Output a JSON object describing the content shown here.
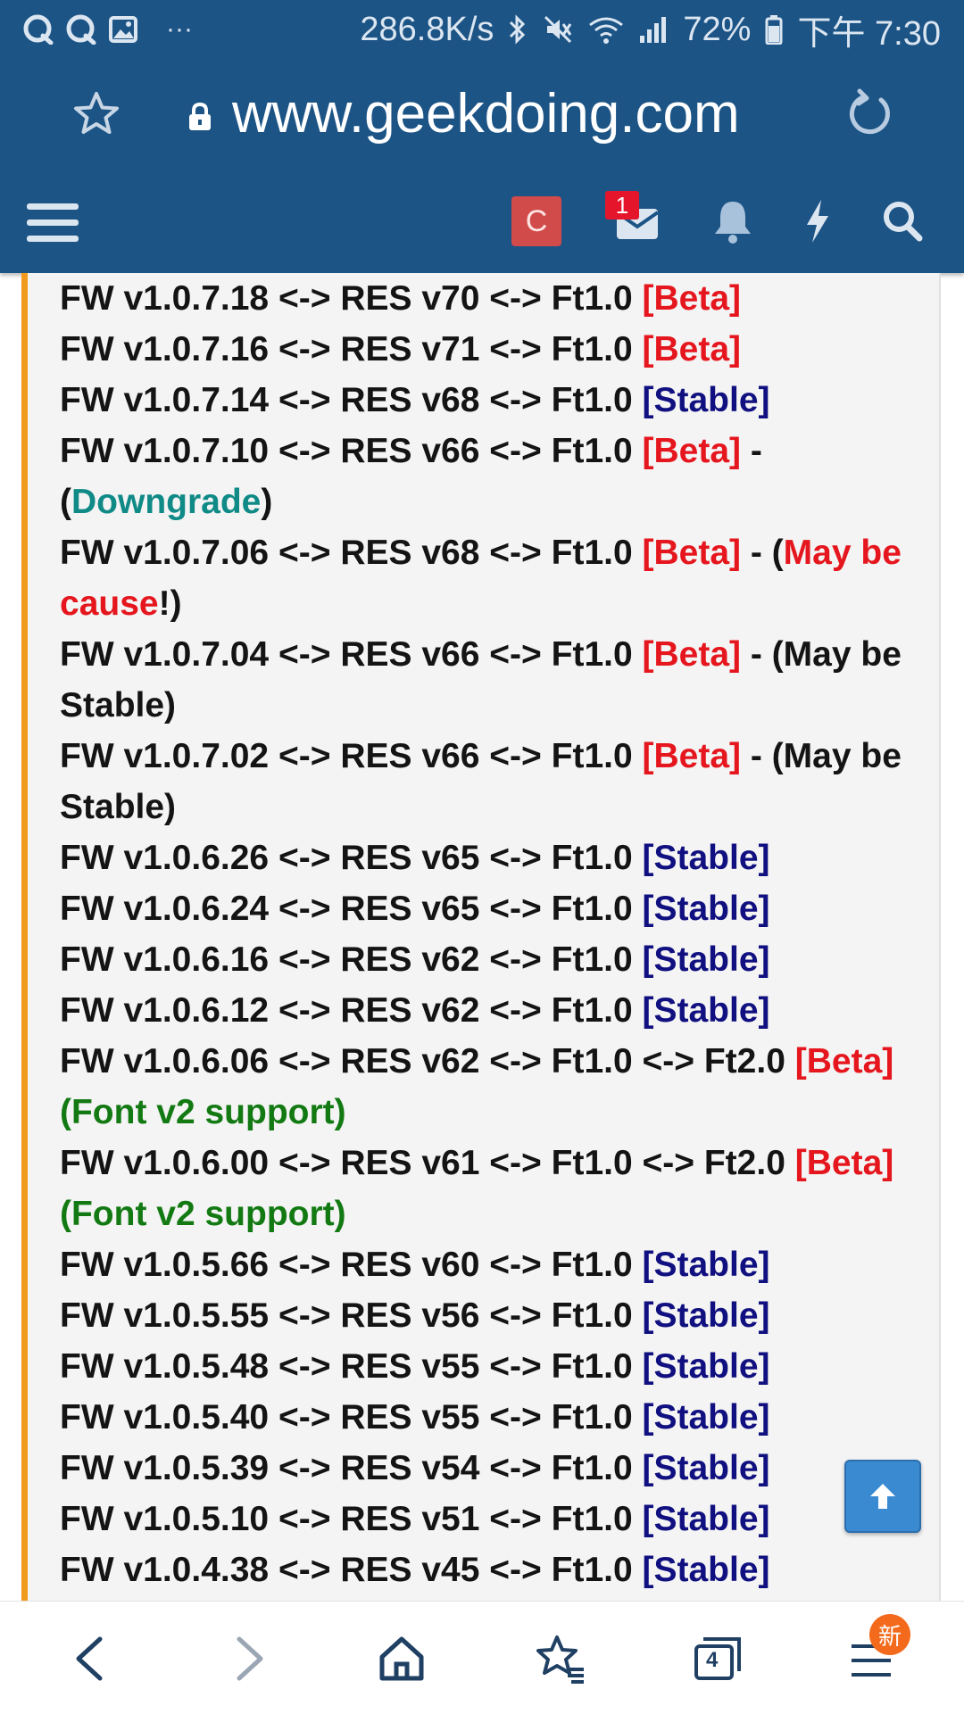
{
  "status_bar": {
    "left_icons": [
      "chat-bubble-q-icon",
      "chat-bubble-q-icon",
      "image-icon"
    ],
    "more": "···",
    "speed": "286.8K/s",
    "battery": "72%",
    "time": "下午 7:30"
  },
  "address_bar": {
    "url": "www.geekdoing.com"
  },
  "site_nav": {
    "avatar_letter": "C",
    "inbox_badge": "1"
  },
  "firmware_list": [
    {
      "main": "FW v1.0.7.18 <-> RES v70 <-> Ft1.0 ",
      "tag": "[Beta]",
      "tag_type": "beta"
    },
    {
      "main": "FW v1.0.7.16 <-> RES v71 <-> Ft1.0 ",
      "tag": "[Beta]",
      "tag_type": "beta"
    },
    {
      "main": "FW v1.0.7.14 <-> RES v68 <-> Ft1.0 ",
      "tag": "[Stable]",
      "tag_type": "stable"
    },
    {
      "main": "FW v1.0.7.10 <-> RES v66 <-> Ft1.0 ",
      "tag": "[Beta]",
      "tag_type": "beta",
      "pre": " - (",
      "note": "Downgrade",
      "note_type": "teal",
      "post": ")"
    },
    {
      "main": "FW v1.0.7.06 <-> RES v68 <-> Ft1.0 ",
      "tag": "[Beta]",
      "tag_type": "beta",
      "pre": " - (",
      "note": "May be cause",
      "note_type": "red",
      "post": "!)"
    },
    {
      "main": "FW v1.0.7.04 <-> RES v66 <-> Ft1.0 ",
      "tag": "[Beta]",
      "tag_type": "beta",
      "pre": " - (",
      "note": "May be Stable",
      "note_type": "plain",
      "post": ")"
    },
    {
      "main": "FW v1.0.7.02 <-> RES v66 <-> Ft1.0 ",
      "tag": "[Beta]",
      "tag_type": "beta",
      "pre": " - (",
      "note": "May be Stable",
      "note_type": "plain",
      "post": ")"
    },
    {
      "main": "FW v1.0.6.26 <-> RES v65 <-> Ft1.0 ",
      "tag": "[Stable]",
      "tag_type": "stable"
    },
    {
      "main": "FW v1.0.6.24 <-> RES v65 <-> Ft1.0 ",
      "tag": "[Stable]",
      "tag_type": "stable"
    },
    {
      "main": "FW v1.0.6.16 <-> RES v62 <-> Ft1.0 ",
      "tag": "[Stable]",
      "tag_type": "stable"
    },
    {
      "main": "FW v1.0.6.12 <-> RES v62 <-> Ft1.0 ",
      "tag": "[Stable]",
      "tag_type": "stable"
    },
    {
      "main": "FW v1.0.6.06 <-> RES v62 <-> Ft1.0 <-> Ft2.0 ",
      "tag": "[Beta]",
      "tag_type": "beta",
      "pre": " ",
      "note": "(Font v2 support)",
      "note_type": "green",
      "post": ""
    },
    {
      "main": "FW v1.0.6.00 <-> RES v61 <-> Ft1.0 <-> Ft2.0 ",
      "tag": "[Beta]",
      "tag_type": "beta",
      "pre": " ",
      "note": "(Font v2 support)",
      "note_type": "green",
      "post": ""
    },
    {
      "main": "FW v1.0.5.66 <-> RES v60 <-> Ft1.0 ",
      "tag": "[Stable]",
      "tag_type": "stable"
    },
    {
      "main": "FW v1.0.5.55 <-> RES v56 <-> Ft1.0 ",
      "tag": "[Stable]",
      "tag_type": "stable"
    },
    {
      "main": "FW v1.0.5.48 <-> RES v55 <-> Ft1.0 ",
      "tag": "[Stable]",
      "tag_type": "stable"
    },
    {
      "main": "FW v1.0.5.40 <-> RES v55 <-> Ft1.0 ",
      "tag": "[Stable]",
      "tag_type": "stable"
    },
    {
      "main": "FW v1.0.5.39 <-> RES v54 <-> Ft1.0 ",
      "tag": "[Stable]",
      "tag_type": "stable"
    },
    {
      "main": "FW v1.0.5.10 <-> RES v51 <-> Ft1.0 ",
      "tag": "[Stable]",
      "tag_type": "stable"
    },
    {
      "main": "FW v1.0.4.38 <-> RES v45 <-> Ft1.0 ",
      "tag": "[Stable]",
      "tag_type": "stable"
    }
  ],
  "bottom_nav": {
    "tab_count": "4",
    "new_badge": "新"
  },
  "colors": {
    "header_blue": "#1c5486",
    "beta_red": "#e5161d",
    "stable_navy": "#101080",
    "note_teal": "#0f8a86",
    "note_green": "#137a13",
    "quote_border": "#f09b1e"
  }
}
